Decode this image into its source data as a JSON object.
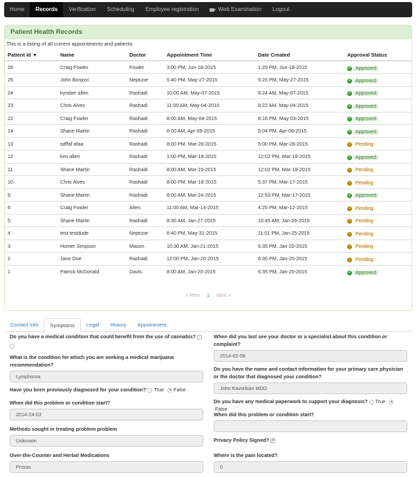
{
  "navbar": {
    "items": [
      {
        "label": "Home",
        "active": false
      },
      {
        "label": "Records",
        "active": true
      },
      {
        "label": "Verification",
        "active": false
      },
      {
        "label": "Scheduling",
        "active": false
      },
      {
        "label": "Employee registration",
        "active": false
      },
      {
        "label": "Web Examination",
        "active": false,
        "icon": "video-camera-icon"
      },
      {
        "label": "Logout",
        "active": false
      }
    ]
  },
  "panel": {
    "title": "Patient Health Records",
    "subtitle": "This is a listing of all current appointments and patients"
  },
  "table": {
    "columns": [
      "Patient Id",
      "Name",
      "Doctor",
      "Appointment Time",
      "Date Created",
      "Approval Status"
    ],
    "rows": [
      {
        "id": "28",
        "name": "Craig Fowler",
        "doctor": "Fowler",
        "appt": "3:00 PM, Jun-18-2015",
        "created": "1:29 PM, Jun-18-2015",
        "status": "Approved"
      },
      {
        "id": "25",
        "name": "John Bonjovi",
        "doctor": "Neptune",
        "appt": "5:40 PM, May-27-2015",
        "created": "5:25 PM, May-27-2015",
        "status": "Approved"
      },
      {
        "id": "24",
        "name": "kymber allen",
        "doctor": "Rashadi",
        "appt": "10:00 AM, May-07-2015",
        "created": "8:24 AM, May-07-2015",
        "status": "Approved"
      },
      {
        "id": "23",
        "name": "Chris Alves",
        "doctor": "Rashadi",
        "appt": "11:00 AM, May-04-2015",
        "created": "8:22 AM, May-04-2015",
        "status": "Approved"
      },
      {
        "id": "22",
        "name": "Craig Fowler",
        "doctor": "Rashadi",
        "appt": "8:00 AM, May-04-2015",
        "created": "8:16 PM, May-03-2015",
        "status": "Approved"
      },
      {
        "id": "14",
        "name": "Shane Martin",
        "doctor": "Rashadi",
        "appt": "8:00 AM, Apr-09-2015",
        "created": "5:04 PM, Apr-08-2015",
        "status": "Approved"
      },
      {
        "id": "13",
        "name": "sdffaf afaa",
        "doctor": "Rashadi",
        "appt": "8:00 PM, Mar-26-2015",
        "created": "5:00 PM, Mar-26-2015",
        "status": "Pending"
      },
      {
        "id": "12",
        "name": "kim allen",
        "doctor": "Rashadi",
        "appt": "1:00 PM, Mar-18-2015",
        "created": "12:02 PM, Mar-18-2015",
        "status": "Approved"
      },
      {
        "id": "11",
        "name": "Shane Martin",
        "doctor": "Rashadi",
        "appt": "8:00 AM, Mar-19-2015",
        "created": "12:02 PM, Mar-18-2015",
        "status": "Pending"
      },
      {
        "id": "10",
        "name": "Chris Alves",
        "doctor": "Rashadi",
        "appt": "8:00 PM, Mar-18-2015",
        "created": "5:37 PM, Mar-17-2015",
        "status": "Pending"
      },
      {
        "id": "9",
        "name": "Shane Martin",
        "doctor": "Rashadi",
        "appt": "8:00 AM, Mar-24-2015",
        "created": "12:53 PM, Mar-17-2015",
        "status": "Approved"
      },
      {
        "id": "6",
        "name": "Craig Fowler",
        "doctor": "Allen",
        "appt": "11:00 AM, Mar-14-2015",
        "created": "4:25 PM, Mar-12-2015",
        "status": "Pending"
      },
      {
        "id": "5",
        "name": "Shane Martin",
        "doctor": "Rashadi",
        "appt": "8:30 AM, Jan-27-2015",
        "created": "10:45 AM, Jan-26-2015",
        "status": "Pending"
      },
      {
        "id": "4",
        "name": "test testdude",
        "doctor": "Neptune",
        "appt": "8:40 PM, May-31-2015",
        "created": "11:01 PM, Jan-25-2015",
        "status": "Pending"
      },
      {
        "id": "3",
        "name": "Homer Simpson",
        "doctor": "Mason",
        "appt": "10:30 AM, Jan-21-2015",
        "created": "6:35 PM, Jan-20-2015",
        "status": "Pending"
      },
      {
        "id": "2",
        "name": "Jane Doe",
        "doctor": "Rashadi",
        "appt": "12:00 PM, Jan-20-2015",
        "created": "6:35 PM, Jan-20-2015",
        "status": "Pending"
      },
      {
        "id": "1",
        "name": "Patrick McDonald",
        "doctor": "Davis",
        "appt": "8:00 AM, Jan-20-2015",
        "created": "6:35 PM, Jan-20-2015",
        "status": "Approved"
      }
    ]
  },
  "pager": {
    "prev": "« Prev",
    "current": "1",
    "next": "Next »"
  },
  "tabs": [
    {
      "label": "Contact Info",
      "active": false
    },
    {
      "label": "Symptoms",
      "active": true
    },
    {
      "label": "Legal",
      "active": false
    },
    {
      "label": "History",
      "active": false
    },
    {
      "label": "Appointment",
      "active": false
    }
  ],
  "form": {
    "cannabis_q": "Do you have a medical condition that could benefit from the use of cannabis?",
    "condition_label": "What is the condition for which you are seeking a medical marijuana recommendation?",
    "condition_value": "Lymphoma",
    "diagnosed_q": "Have you been previously diagnosed for your condition?",
    "opt_true": "True",
    "opt_false": "False",
    "start_label": "When did this problem or condition start?",
    "start_value": "2014-24-03",
    "methods_label": "Methods sought in treating problem problem",
    "methods_value": "Unknown",
    "otc_label": "Over-the-Counter and Herbal Medications",
    "otc_value": "Prozac",
    "last_seen_label": "When did you last see your doctor or a specialist about this condition or complaint?",
    "last_seen_value": "2014-02-08",
    "physician_label": "Do you have the name and contact information for your primary care physician or the doctor that diagnosed your condition?",
    "physician_value": "John Kavorkian MDD",
    "paperwork_q": "Do you have any medical paperwork to support your diagnosis?",
    "start2_label": "When did this problem or condition start?",
    "start2_value": "",
    "privacy_label": "Privacy Policy Signed?",
    "pain_label": "Where is the pain located?",
    "pain_value": "0"
  },
  "colors": {
    "approved": "#3c9a3c",
    "pending": "#b8860b",
    "panel_header_bg": "#dff0d8",
    "navbar_bg": "#222222",
    "link": "#337ab7"
  }
}
